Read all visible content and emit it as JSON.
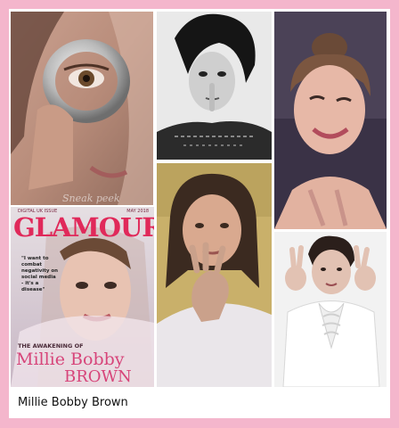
{
  "caption": "Millie Bobby Brown",
  "tiles": {
    "t1": {
      "alt": "Close-up portrait holding a metal ring over eye",
      "watermark": "Sneak peek"
    },
    "t2": {
      "alt": "Black and white portrait with finger to lips"
    },
    "t3": {
      "alt": "Smiling portrait with hair in a bun, winking"
    },
    "t4": {
      "alt": "Glamour magazine cover",
      "kicker": "DIGITAL UK ISSUE",
      "issue": "MAY 2018",
      "masthead": "GLAMOUR",
      "quote": "\"I want to combat negativity on social media - it's a disease\"",
      "subhead": "THE AWAKENING OF",
      "cover_name_1": "Millie Bobby",
      "cover_name_2": "BROWN"
    },
    "t5": {
      "alt": "Selfie making a hand gesture"
    },
    "t6": {
      "alt": "Portrait in white ruffled shirt making hand gestures"
    }
  },
  "colors": {
    "border": "#f4b6cc",
    "glamour_red": "#e0295a",
    "cover_name": "#d7457a"
  }
}
